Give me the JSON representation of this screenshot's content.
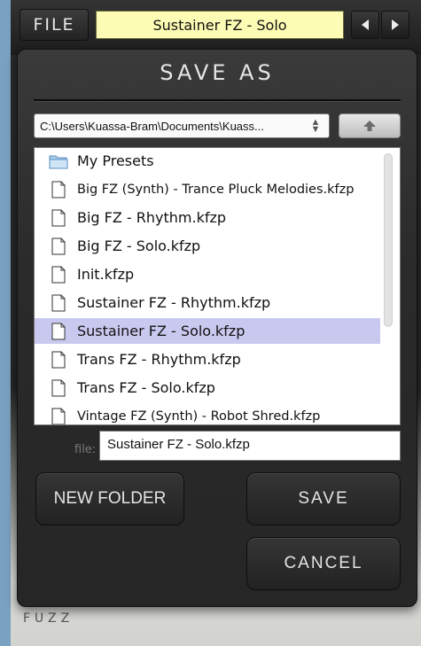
{
  "toolbar": {
    "file_label": "FILE",
    "preset_name": "Sustainer FZ  - Solo",
    "prev_icon": "triangle-left-icon",
    "next_icon": "triangle-right-icon"
  },
  "background": {
    "logo_text": "FUZZ"
  },
  "dialog": {
    "title": "SAVE AS",
    "path": "C:\\Users\\Kuassa-Bram\\Documents\\Kuass...",
    "path_icon": "up-down-arrows-icon",
    "up_icon": "arrow-up-icon",
    "files": [
      {
        "label": "My Presets",
        "icon": "folder-icon",
        "selected": false
      },
      {
        "label": "Big FZ (Synth) - Trance Pluck Melodies.kfzp",
        "icon": "document-icon",
        "selected": false
      },
      {
        "label": "Big FZ - Rhythm.kfzp",
        "icon": "document-icon",
        "selected": false
      },
      {
        "label": "Big FZ - Solo.kfzp",
        "icon": "document-icon",
        "selected": false
      },
      {
        "label": "Init.kfzp",
        "icon": "document-icon",
        "selected": false
      },
      {
        "label": "Sustainer FZ  - Rhythm.kfzp",
        "icon": "document-icon",
        "selected": false
      },
      {
        "label": "Sustainer FZ  - Solo.kfzp",
        "icon": "document-icon",
        "selected": true
      },
      {
        "label": "Trans FZ - Rhythm.kfzp",
        "icon": "document-icon",
        "selected": false
      },
      {
        "label": "Trans FZ - Solo.kfzp",
        "icon": "document-icon",
        "selected": false
      },
      {
        "label": "Vintage FZ (Synth) - Robot Shred.kfzp",
        "icon": "document-icon",
        "selected": false
      }
    ],
    "file_label": "file:",
    "file_value": "Sustainer FZ  - Solo.kfzp",
    "new_folder_label": "NEW FOLDER",
    "save_label": "SAVE",
    "cancel_label": "CANCEL"
  },
  "colors": {
    "selected_row": "#c9c9f0",
    "preset_display": "#fcfcb4"
  }
}
